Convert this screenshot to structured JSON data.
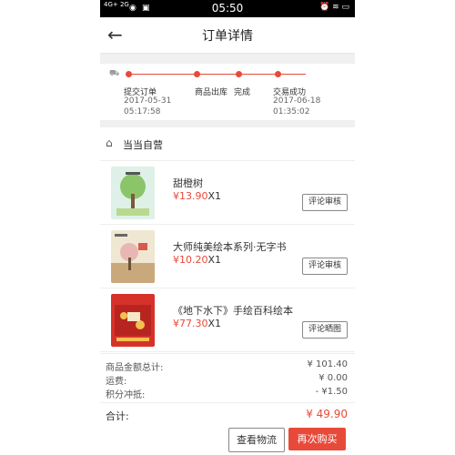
{
  "status_bar": {
    "signal": "4G+ 2G",
    "time": "05:50",
    "battery_icon": "battery-icon"
  },
  "header": {
    "title": "订单详情",
    "back_icon": "arrow-left-icon"
  },
  "timeline": {
    "steps": [
      {
        "label": "提交订单",
        "date": "2017-05-31",
        "time": "05:17:58"
      },
      {
        "label": "商品出库",
        "date": "",
        "time": ""
      },
      {
        "label": "完成",
        "date": "",
        "time": ""
      },
      {
        "label": "交易成功",
        "date": "2017-06-18",
        "time": "01:35:02"
      }
    ],
    "accent_color": "#e84a3a"
  },
  "store": {
    "name": "当当自营",
    "icon": "home-icon"
  },
  "items": [
    {
      "name": "甜橙树",
      "price": "¥13.90",
      "qty": "X1",
      "button": "评论审核"
    },
    {
      "name": "大师纯美绘本系列·无字书",
      "price": "¥10.20",
      "qty": "X1",
      "button": "评论审核"
    },
    {
      "name": "《地下水下》手绘百科绘本",
      "price": "¥77.30",
      "qty": "X1",
      "button": "评论晒图"
    }
  ],
  "summary": {
    "rows": [
      {
        "label": "商品金额总计:",
        "value": "¥ 101.40"
      },
      {
        "label": "运费:",
        "value": "¥ 0.00"
      },
      {
        "label": "积分冲抵:",
        "value": "- ¥1.50"
      }
    ],
    "total_label": "合计:",
    "total_value": "¥ 49.90"
  },
  "actions": {
    "logistics": "查看物流",
    "buy_again": "再次购买"
  }
}
